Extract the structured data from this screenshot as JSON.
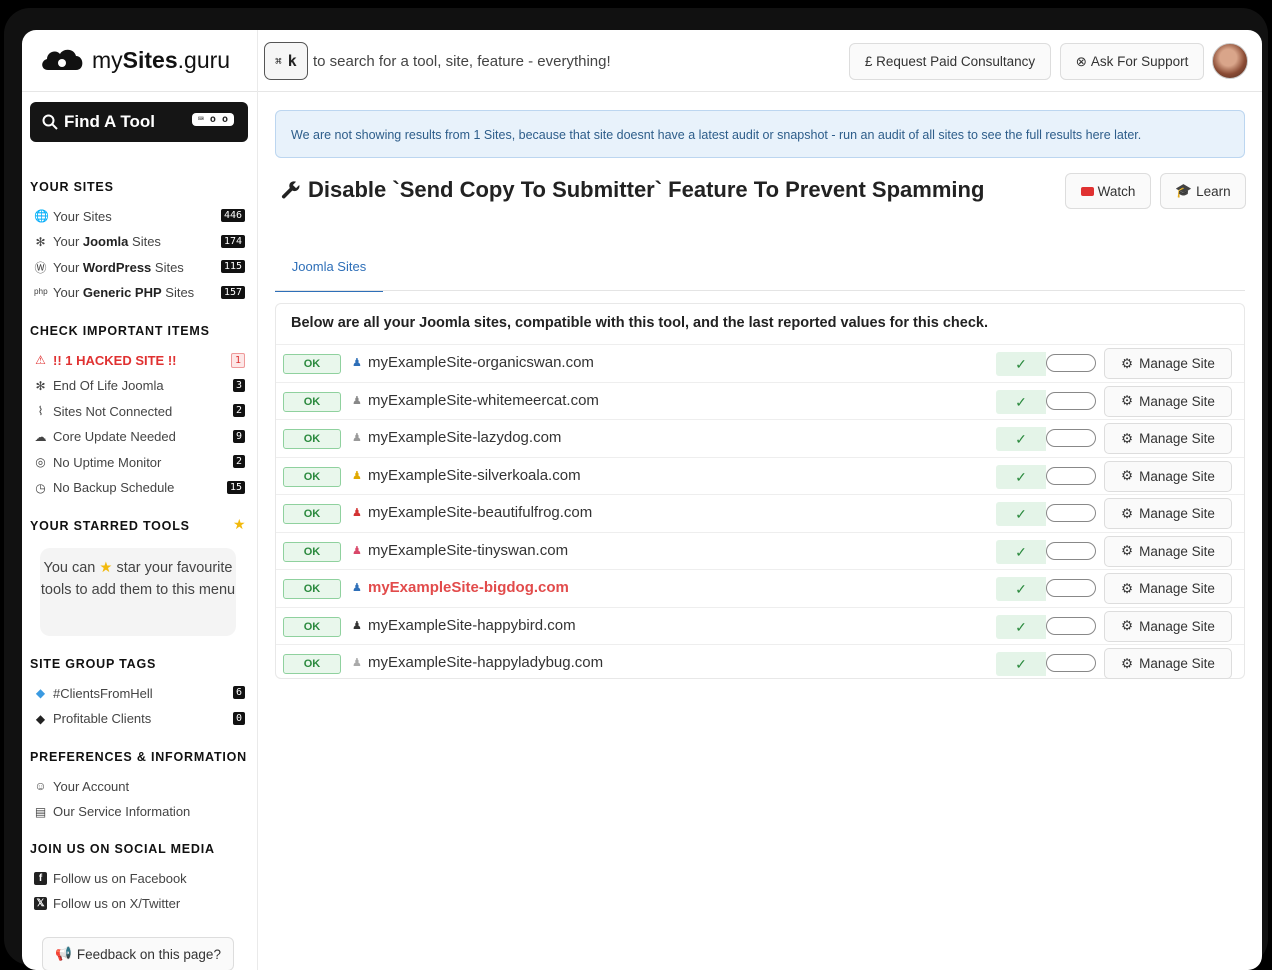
{
  "app": {
    "brand_light": "my",
    "brand_bold": "Sites",
    "brand_suffix": ".guru"
  },
  "header": {
    "kbd_symbol": "⌘",
    "kbd_key": "k",
    "search_hint": "to search for a tool, site, feature - everything!",
    "consultancy_label": "£ Request Paid Consultancy",
    "support_label": "Ask For Support"
  },
  "sidebar": {
    "find_tool_label": "Find A Tool",
    "find_tool_shortcut": "⌨ o o",
    "your_sites_title": "YOUR SITES",
    "your_sites": [
      {
        "icon": "globe-icon",
        "glyph": "🌐",
        "prefix": "Your ",
        "bold": "",
        "suffix": "Sites",
        "count": "446"
      },
      {
        "icon": "joomla-icon",
        "glyph": "✻",
        "prefix": "Your ",
        "bold": "Joomla",
        "suffix": " Sites",
        "count": "174"
      },
      {
        "icon": "wordpress-icon",
        "glyph": "Ⓦ",
        "prefix": "Your ",
        "bold": "WordPress",
        "suffix": " Sites",
        "count": "115"
      },
      {
        "icon": "php-icon",
        "glyph": "ᵖʰᵖ",
        "prefix": "Your ",
        "bold": "Generic PHP",
        "suffix": " Sites",
        "count": "157"
      }
    ],
    "check_title": "CHECK IMPORTANT ITEMS",
    "checks": [
      {
        "icon": "hacked-icon",
        "glyph": "⚠",
        "label": "!! 1 HACKED SITE !!",
        "count": "1",
        "alert": true
      },
      {
        "icon": "joomla-icon",
        "glyph": "✻",
        "label": "End Of Life Joomla",
        "count": "3"
      },
      {
        "icon": "wifi-off-icon",
        "glyph": "⌇",
        "label": "Sites Not Connected",
        "count": "2"
      },
      {
        "icon": "cloud-upload-icon",
        "glyph": "☁",
        "label": "Core Update Needed",
        "count": "9"
      },
      {
        "icon": "target-icon",
        "glyph": "◎",
        "label": "No Uptime Monitor",
        "count": "2"
      },
      {
        "icon": "clock-icon",
        "glyph": "◷",
        "label": "No Backup Schedule",
        "count": "15"
      }
    ],
    "starred_title": "YOUR STARRED TOOLS",
    "starred_tip_1": "You can",
    "starred_tip_2": "star your favourite tools to add them to this menu",
    "tags_title": "SITE GROUP TAGS",
    "tags": [
      {
        "label": "#ClientsFromHell",
        "count": "6",
        "color": "#3b9ae1"
      },
      {
        "label": "Profitable Clients",
        "count": "0",
        "color": "#222222"
      }
    ],
    "prefs_title": "PREFERENCES & INFORMATION",
    "prefs": [
      {
        "icon": "user-icon",
        "glyph": "☺",
        "label": "Your Account"
      },
      {
        "icon": "document-icon",
        "glyph": "▤",
        "label": "Our Service Information"
      }
    ],
    "social_title": "JOIN US ON SOCIAL MEDIA",
    "social": [
      {
        "icon": "facebook-icon",
        "glyph": "f",
        "label": "Follow us on Facebook"
      },
      {
        "icon": "x-twitter-icon",
        "glyph": "𝕏",
        "label": "Follow us on X/Twitter"
      }
    ],
    "feedback_label": "Feedback on this page?"
  },
  "main": {
    "alert_text": "We are not showing results from 1 Sites, because that site doesnt have a latest audit or snapshot - run an audit of all sites to see the full results here later.",
    "tool_title": "Disable `Send Copy To Submitter` Feature To Prevent Spamming",
    "watch_label": "Watch",
    "learn_label": "Learn",
    "tab_label": "Joomla Sites",
    "panel_heading": "Below are all your Joomla sites, compatible with this tool, and the last reported values for this check.",
    "ok_label": "OK",
    "manage_label": "Manage Site",
    "sites": [
      {
        "name": "myExampleSite-organicswan.com",
        "icon_color": "#2e6fb8",
        "highlight": false
      },
      {
        "name": "myExampleSite-whitemeercat.com",
        "icon_color": "#888888",
        "highlight": false
      },
      {
        "name": "myExampleSite-lazydog.com",
        "icon_color": "#999999",
        "highlight": false
      },
      {
        "name": "myExampleSite-silverkoala.com",
        "icon_color": "#e0a800",
        "highlight": false
      },
      {
        "name": "myExampleSite-beautifulfrog.com",
        "icon_color": "#d33333",
        "highlight": false
      },
      {
        "name": "myExampleSite-tinyswan.com",
        "icon_color": "#d9486a",
        "highlight": false
      },
      {
        "name": "myExampleSite-bigdog.com",
        "icon_color": "#2e6fb8",
        "highlight": true
      },
      {
        "name": "myExampleSite-happybird.com",
        "icon_color": "#333333",
        "highlight": false
      },
      {
        "name": "myExampleSite-happyladybug.com",
        "icon_color": "#aaaaaa",
        "highlight": false
      }
    ]
  }
}
